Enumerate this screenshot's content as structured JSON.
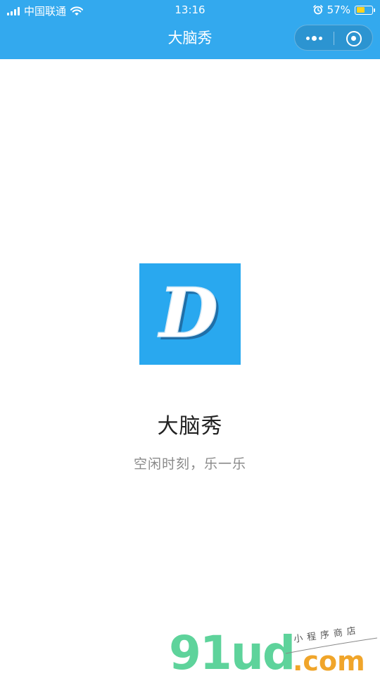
{
  "status_bar": {
    "carrier": "中国联通",
    "time": "13:16",
    "battery": "57%",
    "battery_level": 0.57,
    "battery_color": "#ffd21f"
  },
  "nav": {
    "title": "大脑秀",
    "background": "#33a9ee",
    "more_icon": "more-dots-icon",
    "close_icon": "record-close-icon"
  },
  "splash": {
    "logo_letter": "D",
    "logo_background": "#29a8ef",
    "app_name": "大脑秀",
    "slogan": "空闲时刻，乐一乐"
  },
  "watermark": {
    "text": "91ud",
    "domain": ".com",
    "tagline": "小程序商店"
  }
}
